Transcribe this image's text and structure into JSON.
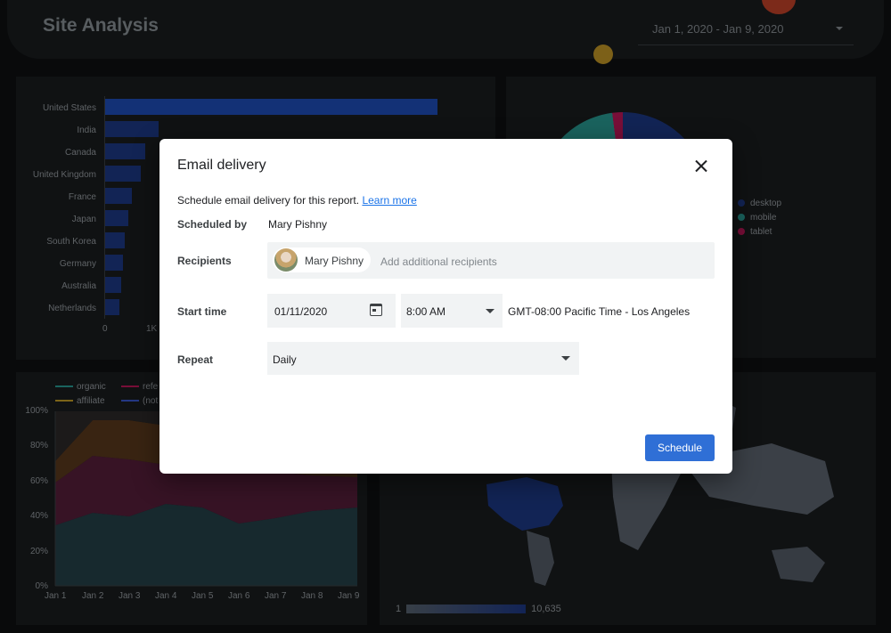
{
  "header": {
    "title": "Site Analysis",
    "date_range": "Jan 1, 2020 - Jan 9, 2020"
  },
  "bar_chart": {
    "countries": [
      "United States",
      "India",
      "Canada",
      "United Kingdom",
      "France",
      "Japan",
      "South Korea",
      "Germany",
      "Australia",
      "Netherlands"
    ],
    "ticks": [
      "0",
      "1K"
    ]
  },
  "pie_chart": {
    "legend": [
      "desktop",
      "mobile",
      "tablet"
    ],
    "colors": [
      "#1e3a8a",
      "#2aa198",
      "#c2185b"
    ]
  },
  "area_chart": {
    "legend": [
      "organic",
      "refe",
      "affiliate",
      "(not"
    ],
    "y_ticks": [
      "100%",
      "80%",
      "60%",
      "40%",
      "20%",
      "0%"
    ],
    "x_ticks": [
      "Jan 1",
      "Jan 2",
      "Jan 3",
      "Jan 4",
      "Jan 5",
      "Jan 6",
      "Jan 7",
      "Jan 8",
      "Jan 9"
    ]
  },
  "map": {
    "scale_min": "1",
    "scale_max": "10,635"
  },
  "dialog": {
    "title": "Email delivery",
    "description": "Schedule email delivery for this report.",
    "learn_more": "Learn more",
    "scheduled_by_label": "Scheduled by",
    "scheduled_by_value": "Mary Pishny",
    "recipients_label": "Recipients",
    "recipient_chip": "Mary Pishny",
    "recipients_placeholder": "Add additional recipients",
    "start_time_label": "Start time",
    "start_date": "01/11/2020",
    "start_hour": "8:00 AM",
    "timezone": "GMT-08:00 Pacific Time - Los Angeles",
    "repeat_label": "Repeat",
    "repeat_value": "Daily",
    "schedule_button": "Schedule"
  }
}
